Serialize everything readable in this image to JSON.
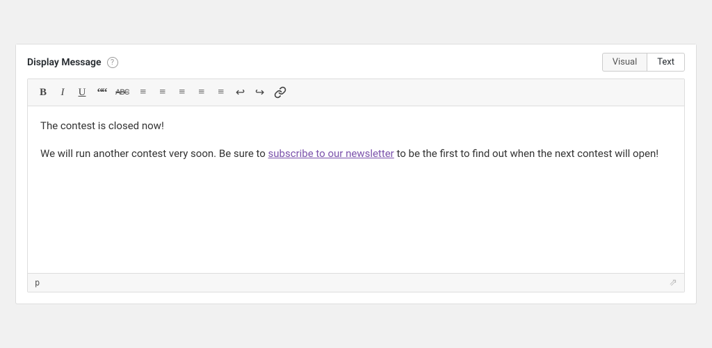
{
  "header": {
    "title": "Display Message",
    "help_tooltip": "?",
    "tabs": [
      {
        "label": "Visual",
        "id": "visual",
        "active": false
      },
      {
        "label": "Text",
        "id": "text",
        "active": true
      }
    ]
  },
  "toolbar": {
    "buttons": [
      {
        "name": "bold",
        "symbol": "B",
        "title": "Bold"
      },
      {
        "name": "italic",
        "symbol": "I",
        "title": "Italic"
      },
      {
        "name": "underline",
        "symbol": "U",
        "title": "Underline"
      },
      {
        "name": "blockquote",
        "symbol": "““",
        "title": "Blockquote"
      },
      {
        "name": "strikethrough",
        "symbol": "ABC",
        "title": "Strikethrough"
      },
      {
        "name": "unordered-list",
        "symbol": "☰",
        "title": "Unordered List"
      },
      {
        "name": "ordered-list",
        "symbol": "☰",
        "title": "Ordered List"
      },
      {
        "name": "align-left",
        "symbol": "≡",
        "title": "Align Left"
      },
      {
        "name": "align-center",
        "symbol": "≡",
        "title": "Align Center"
      },
      {
        "name": "align-right",
        "symbol": "≡",
        "title": "Align Right"
      },
      {
        "name": "undo",
        "symbol": "↩",
        "title": "Undo"
      },
      {
        "name": "redo",
        "symbol": "↪",
        "title": "Redo"
      },
      {
        "name": "link",
        "symbol": "🔗",
        "title": "Insert Link"
      }
    ]
  },
  "content": {
    "paragraph1": "The contest is closed now!",
    "paragraph2_prefix": "We will run another contest very soon. Be sure to ",
    "link_text": "subscribe to our newsletter",
    "link_href": "#",
    "paragraph2_suffix": " to be the first to find out when the next contest will open!"
  },
  "footer": {
    "tag_label": "p",
    "resize_icon": "⤡"
  }
}
